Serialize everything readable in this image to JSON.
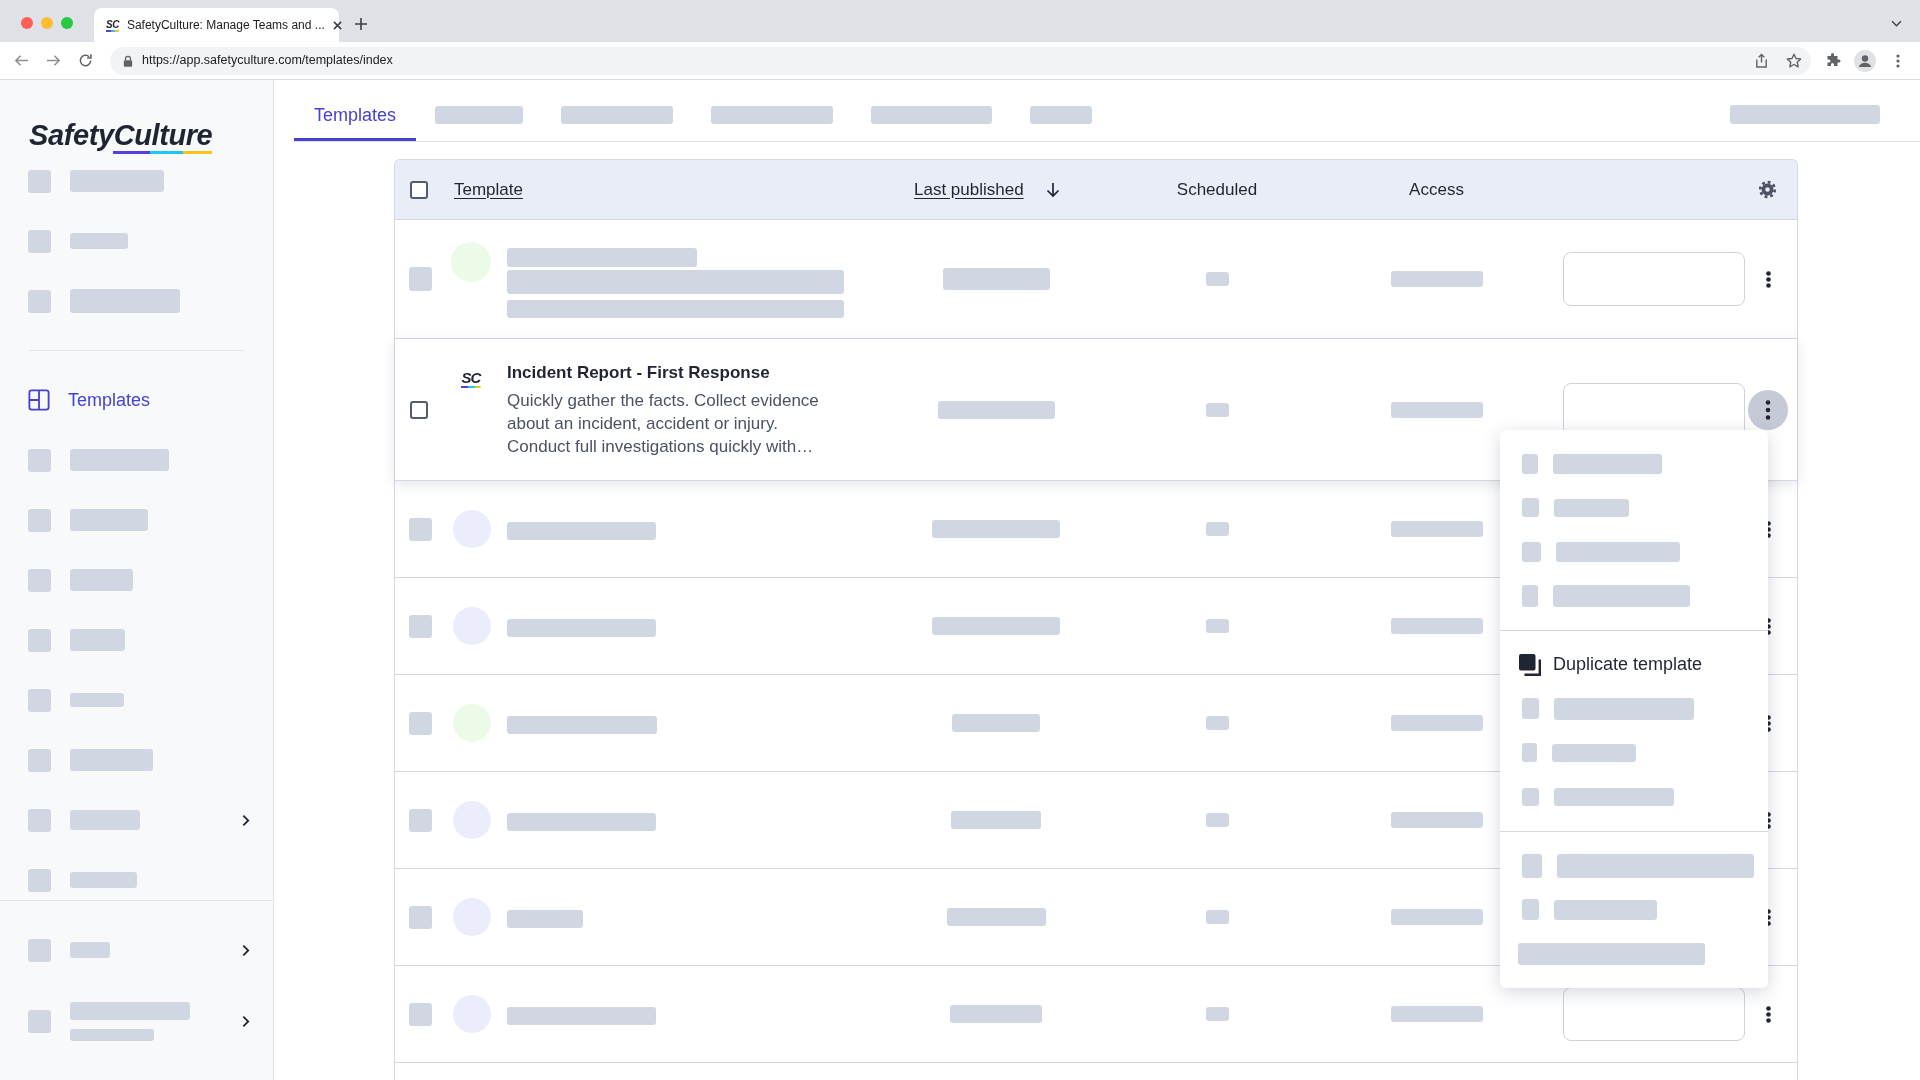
{
  "browser": {
    "tabs": [
      {
        "icon_text": "SC",
        "title": "SafetyCulture: Manage Teams and ...",
        "selected": true
      }
    ],
    "url": "https://app.safetyculture.com/templates/index"
  },
  "sidebar": {
    "logo": "SafetyCulture",
    "sections": [
      {
        "items": [
          {
            "kind": "placeholder",
            "selected": false
          },
          {
            "kind": "placeholder",
            "selected": false
          },
          {
            "kind": "placeholder",
            "selected": false
          }
        ]
      },
      {
        "items": [
          {
            "kind": "link",
            "label": "Templates",
            "selected": true
          },
          {
            "kind": "placeholder",
            "selected": false
          },
          {
            "kind": "placeholder",
            "selected": false
          },
          {
            "kind": "placeholder",
            "selected": false
          },
          {
            "kind": "placeholder",
            "selected": false
          },
          {
            "kind": "placeholder",
            "selected": false
          },
          {
            "kind": "placeholder",
            "selected": false
          },
          {
            "kind": "placeholder_group",
            "selected": false
          },
          {
            "kind": "placeholder",
            "selected": false
          }
        ]
      },
      {
        "items": [
          {
            "kind": "placeholder_group",
            "selected": false
          },
          {
            "kind": "placeholder_group_two_line",
            "selected": false
          }
        ]
      }
    ]
  },
  "tabs": [
    {
      "kind": "tab",
      "label": "Templates",
      "selected": true
    },
    {
      "kind": "placeholder",
      "selected": false
    },
    {
      "kind": "placeholder",
      "selected": false
    },
    {
      "kind": "placeholder",
      "selected": false
    },
    {
      "kind": "placeholder",
      "selected": false
    },
    {
      "kind": "placeholder",
      "selected": false
    }
  ],
  "table": {
    "select_all": {
      "checked": false
    },
    "columns": [
      {
        "label": "Template",
        "sortable": true,
        "sorted": false
      },
      {
        "label": "Last published",
        "sortable": true,
        "sorted": true
      },
      {
        "label": "Scheduled",
        "sortable": false,
        "sorted": false
      },
      {
        "label": "Access",
        "sortable": false,
        "sorted": false
      }
    ],
    "rows": [
      {
        "kind": "placeholder_detailed",
        "color": "#ebfbe7",
        "menu_open": false
      },
      {
        "kind": "template",
        "icon_text": "SC",
        "title": "Incident Report - First Response",
        "description": "Quickly gather the facts. Collect evidence about an incident, accident or injury. Conduct full investigations quickly with…",
        "checked": false,
        "menu_open": true,
        "menu": {
          "sections": [
            {
              "items": [
                {
                  "kind": "placeholder"
                },
                {
                  "kind": "placeholder"
                },
                {
                  "kind": "placeholder"
                },
                {
                  "kind": "placeholder"
                }
              ]
            },
            {
              "items": [
                {
                  "kind": "action",
                  "label": "Duplicate template"
                },
                {
                  "kind": "placeholder"
                },
                {
                  "kind": "placeholder"
                },
                {
                  "kind": "placeholder"
                }
              ]
            },
            {
              "items": [
                {
                  "kind": "placeholder"
                },
                {
                  "kind": "placeholder"
                },
                {
                  "kind": "placeholder_text"
                }
              ]
            }
          ]
        }
      },
      {
        "kind": "placeholder",
        "color": "#ebedfc",
        "menu_open": false
      },
      {
        "kind": "placeholder",
        "color": "#ebedfc",
        "menu_open": false
      },
      {
        "kind": "placeholder",
        "color": "#ebfbe7",
        "menu_open": false
      },
      {
        "kind": "placeholder",
        "color": "#ebedfc",
        "menu_open": false
      },
      {
        "kind": "placeholder",
        "color": "#ebedfc",
        "menu_open": false
      },
      {
        "kind": "placeholder",
        "color": "#ebedfc",
        "menu_open": false
      }
    ]
  }
}
